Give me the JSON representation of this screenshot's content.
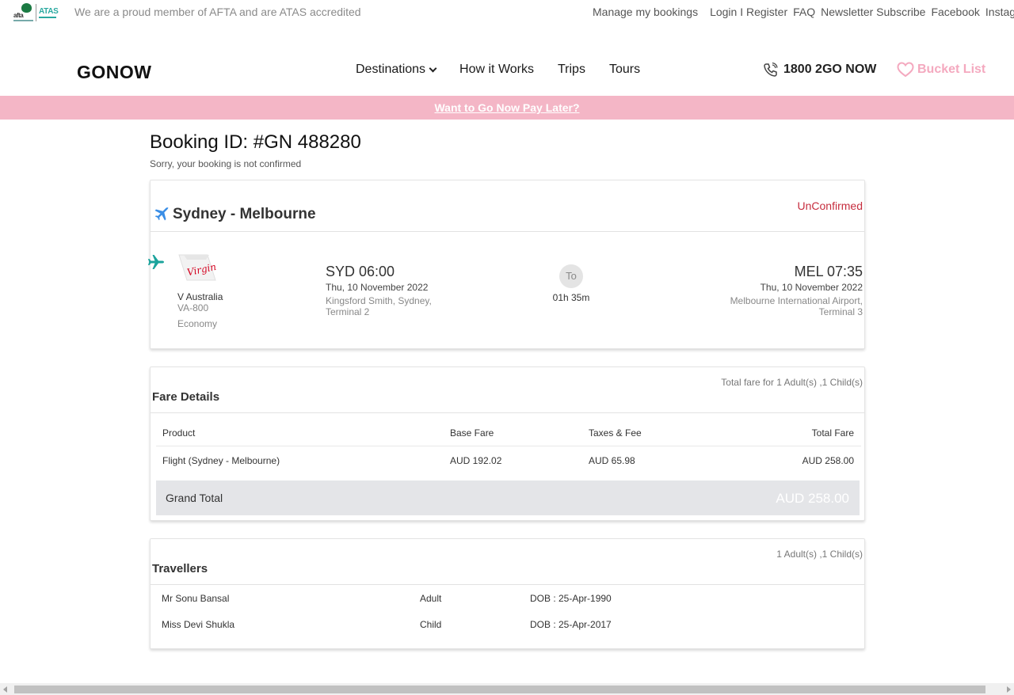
{
  "topbar": {
    "afta_logo_text": "afta",
    "atas_logo_text": "ATAS",
    "member_text": "We are a proud member of AFTA and are ATAS accredited",
    "links": [
      "Manage my bookings",
      "Login I Register",
      "FAQ",
      "Newsletter Subscribe",
      "Facebook",
      "Instagram"
    ]
  },
  "header": {
    "brand": "GONOW",
    "nav": [
      "Destinations",
      "How it Works",
      "Trips",
      "Tours"
    ],
    "phone": "1800 2GO NOW",
    "bucket_list": "Bucket List"
  },
  "promo": {
    "text": "Want to Go Now Pay Later?"
  },
  "booking": {
    "title": "Booking ID: #GN 488280",
    "subtitle": "Sorry, your booking is not confirmed"
  },
  "flight": {
    "route": "Sydney - Melbourne",
    "status": "UnConfirmed",
    "airline_logo_text": "Virgin",
    "airline": "V Australia",
    "flight_no": "VA-800",
    "cabin": "Economy",
    "departure": {
      "time": "SYD 06:00",
      "date": "Thu, 10 November 2022",
      "airport": "Kingsford Smith, Sydney,",
      "terminal": "Terminal 2"
    },
    "to_label": "To",
    "duration": "01h 35m",
    "arrival": {
      "time": "MEL 07:35",
      "date": "Thu, 10 November 2022",
      "airport": "Melbourne International Airport,",
      "terminal": "Terminal 3"
    }
  },
  "fare": {
    "title": "Fare Details",
    "meta": "Total fare for 1 Adult(s) ,1 Child(s)",
    "headers": [
      "Product",
      "Base Fare",
      "Taxes & Fee",
      "Total Fare"
    ],
    "rows": [
      [
        "Flight (Sydney - Melbourne)",
        "AUD 192.02",
        "AUD 65.98",
        "AUD 258.00"
      ]
    ],
    "grand_total_label": "Grand Total",
    "grand_total_value": "AUD 258.00"
  },
  "travellers": {
    "title": "Travellers",
    "meta": "1 Adult(s) ,1 Child(s)",
    "rows": [
      [
        "Mr Sonu Bansal",
        "Adult",
        "DOB : 25-Apr-1990"
      ],
      [
        "Miss Devi Shukla",
        "Child",
        "DOB : 25-Apr-2017"
      ]
    ]
  },
  "colors": {
    "promo_bg": "#f4b6c6",
    "status_red": "#c62d3e",
    "bucket_pink": "#f4a9bf",
    "plane_blue": "#3a8ee6",
    "plane_teal": "#1ba39c",
    "virgin_red": "#d4001e"
  },
  "icons": [
    "plane-icon",
    "chevron-down-icon",
    "phone-icon",
    "heart-icon"
  ]
}
